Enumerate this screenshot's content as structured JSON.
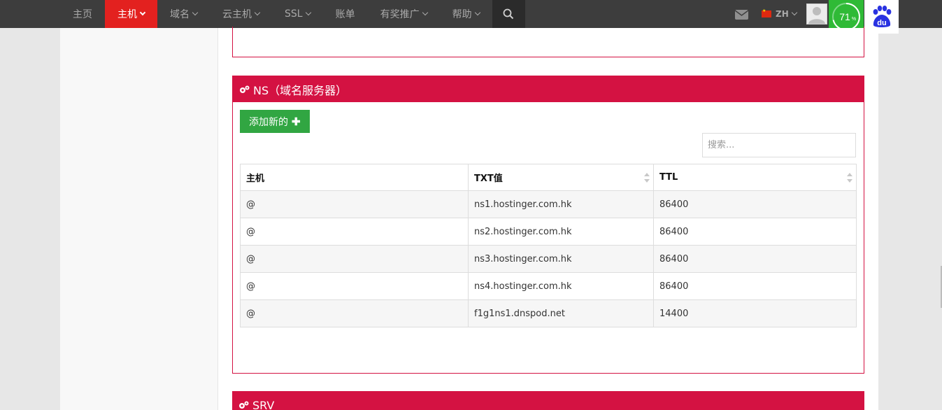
{
  "nav": {
    "items": [
      {
        "label": "主页",
        "dropdown": false,
        "active": false
      },
      {
        "label": "主机",
        "dropdown": true,
        "active": true
      },
      {
        "label": "域名",
        "dropdown": true,
        "active": false
      },
      {
        "label": "云主机",
        "dropdown": true,
        "active": false
      },
      {
        "label": "SSL",
        "dropdown": true,
        "active": false
      },
      {
        "label": "账单",
        "dropdown": false,
        "active": false
      },
      {
        "label": "有奖推广",
        "dropdown": true,
        "active": false
      },
      {
        "label": "帮助",
        "dropdown": true,
        "active": false
      }
    ],
    "search_icon": "search-icon"
  },
  "header_right": {
    "mail_icon": "envelope-icon",
    "language": "ZH",
    "flag": "china-flag-icon",
    "badge": {
      "value": "71",
      "unit": "%",
      "fraction": 0.71
    },
    "baidu_logo": "du"
  },
  "ns_panel": {
    "title": "NS（域名服务器）",
    "add_button": "添加新的",
    "search_placeholder": "搜索...",
    "columns": [
      "主机",
      "TXT值",
      "TTL"
    ],
    "rows": [
      {
        "host": "@",
        "value": "ns1.hostinger.com.hk",
        "ttl": "86400"
      },
      {
        "host": "@",
        "value": "ns2.hostinger.com.hk",
        "ttl": "86400"
      },
      {
        "host": "@",
        "value": "ns3.hostinger.com.hk",
        "ttl": "86400"
      },
      {
        "host": "@",
        "value": "ns4.hostinger.com.hk",
        "ttl": "86400"
      },
      {
        "host": "@",
        "value": "f1g1ns1.dnspod.net",
        "ttl": "14400"
      }
    ]
  },
  "srv_panel": {
    "title": "SRV"
  },
  "colors": {
    "nav_bg": "#3d3d3d",
    "nav_active": "#e3211f",
    "panel_accent": "#d41242",
    "add_button": "#31a642",
    "badge_green": "#2fba36",
    "baidu_blue": "#2932e1"
  }
}
